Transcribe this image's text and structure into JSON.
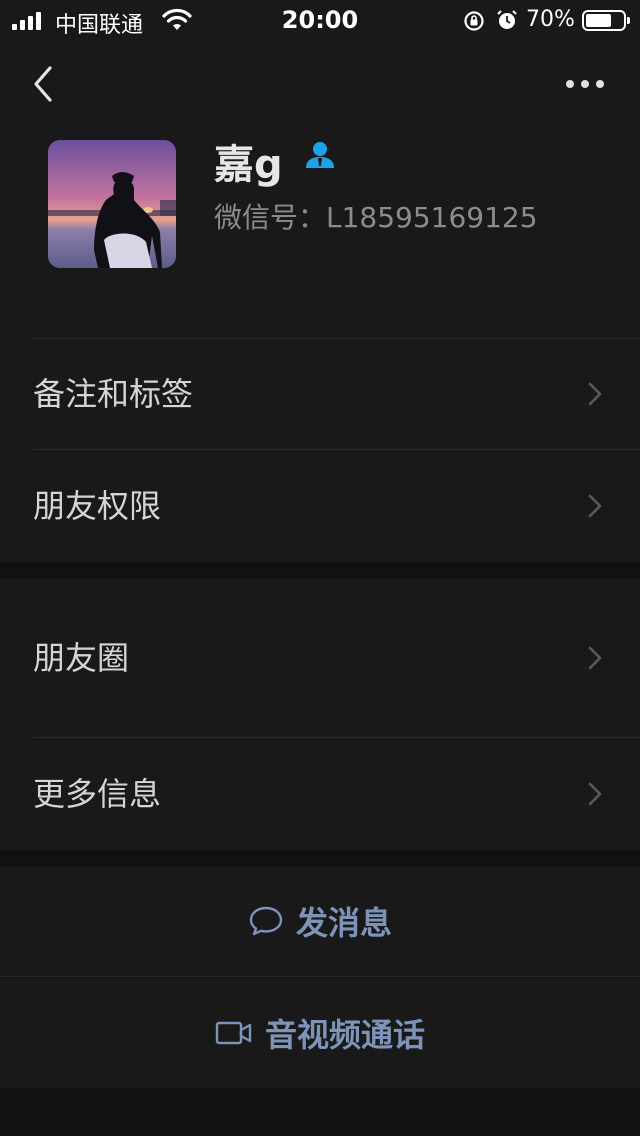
{
  "status_bar": {
    "carrier": "中国联通",
    "time": "20:00",
    "battery_percent": "70%",
    "battery_level": 0.7
  },
  "profile": {
    "name": "嘉g",
    "wechat_id": "微信号：L18595169125"
  },
  "menu_group_1": [
    {
      "label": "备注和标签"
    },
    {
      "label": "朋友权限"
    }
  ],
  "menu_group_2": [
    {
      "label": "朋友圈"
    },
    {
      "label": "更多信息"
    }
  ],
  "actions": {
    "message_label": "发消息",
    "call_label": "音视频通话"
  },
  "colors": {
    "background": "#111111",
    "card": "#191919",
    "accent_link": "#7d93b8",
    "contact_icon": "#1aa3e8"
  },
  "icons": [
    "back-icon",
    "more-icon",
    "contact-icon",
    "chevron-right-icon",
    "chat-bubble-icon",
    "video-camera-icon"
  ]
}
